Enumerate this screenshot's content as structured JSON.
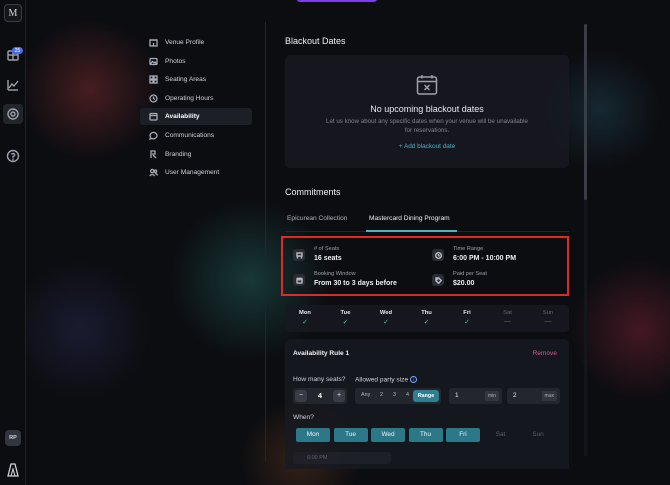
{
  "rail": {
    "logo_text": "M",
    "badge_count": "25",
    "avatar_initials": "RP",
    "icons": [
      "grid-icon",
      "chart-icon",
      "gear-icon",
      "help-icon",
      "brand-logo-icon"
    ]
  },
  "nav": {
    "items": [
      {
        "label": "Venue Profile",
        "icon": "building-icon"
      },
      {
        "label": "Photos",
        "icon": "photo-icon"
      },
      {
        "label": "Seating Areas",
        "icon": "seating-icon"
      },
      {
        "label": "Operating Hours",
        "icon": "clock-icon"
      },
      {
        "label": "Availability",
        "icon": "calendar-icon",
        "active": true
      },
      {
        "label": "Communications",
        "icon": "chat-icon"
      },
      {
        "label": "Branding",
        "icon": "brush-icon"
      },
      {
        "label": "User Management",
        "icon": "users-icon"
      }
    ]
  },
  "blackout": {
    "title": "Blackout Dates",
    "empty_title": "No upcoming blackout dates",
    "empty_desc": "Let us know about any specific dates when your venue will be unavailable for reservations.",
    "add_label": "+  Add blackout date"
  },
  "commitments": {
    "title": "Commitments",
    "tabs": [
      {
        "label": "Epicurean Collection",
        "active": false
      },
      {
        "label": "Mastercard Dining Program",
        "active": true
      }
    ],
    "info": {
      "seats_label": "# of Seats",
      "seats_value": "16 seats",
      "time_label": "Time Range",
      "time_value": "6:00 PM - 10:00 PM",
      "window_label": "Booking Window",
      "window_value": "From 30 to 3 days before",
      "paid_label": "Paid per Seat",
      "paid_value": "$20.00"
    },
    "days": [
      {
        "label": "Mon",
        "mark": "✓",
        "on": true
      },
      {
        "label": "Tue",
        "mark": "✓",
        "on": true
      },
      {
        "label": "Wed",
        "mark": "✓",
        "on": true
      },
      {
        "label": "Thu",
        "mark": "✓",
        "on": true
      },
      {
        "label": "Fri",
        "mark": "✓",
        "on": true
      },
      {
        "label": "Sat",
        "mark": "—",
        "on": false
      },
      {
        "label": "Sun",
        "mark": "—",
        "on": false
      }
    ]
  },
  "rule": {
    "title": "Availability Rule 1",
    "remove_label": "Remove",
    "seats_question": "How many seats?",
    "party_question": "Allowed party size",
    "seats_value": "4",
    "minus": "−",
    "plus": "+",
    "party_options": [
      "Any",
      "2",
      "3",
      "4"
    ],
    "party_range_label": "Range",
    "min_value": "1",
    "min_unit": "min",
    "max_value": "2",
    "max_unit": "max",
    "when_label": "When?",
    "weekdays": [
      {
        "label": "Mon",
        "on": true
      },
      {
        "label": "Tue",
        "on": true
      },
      {
        "label": "Wed",
        "on": true
      },
      {
        "label": "Thu",
        "on": true
      },
      {
        "label": "Fri",
        "on": true
      },
      {
        "label": "Sat",
        "on": false
      },
      {
        "label": "Sun",
        "on": false
      }
    ],
    "time_start": "6:00 PM"
  },
  "colors": {
    "accent": "#4bb3c8",
    "check": "#52c3a6",
    "remove": "#d05a8a",
    "highlight": "#e02a20"
  }
}
